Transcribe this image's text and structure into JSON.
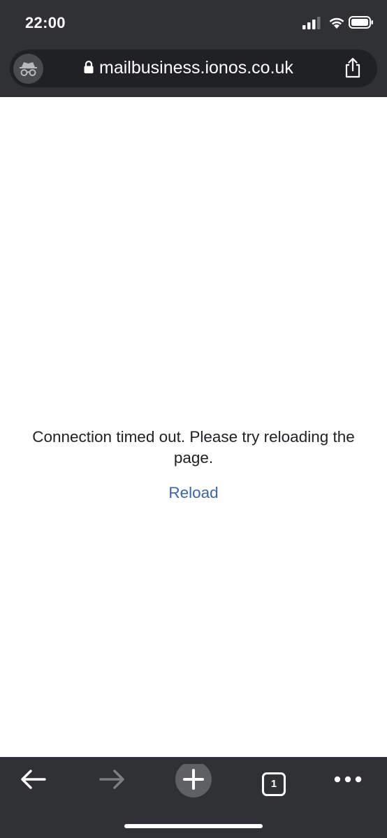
{
  "status_bar": {
    "time": "22:00",
    "icons": [
      "signal-icon",
      "wifi-icon",
      "battery-icon"
    ]
  },
  "address_bar": {
    "url": "mailbusiness.ionos.co.uk",
    "icons": [
      "incognito-icon",
      "lock-icon",
      "share-icon"
    ]
  },
  "page": {
    "error_message": "Connection timed out. Please try reloading the page.",
    "reload_label": "Reload"
  },
  "toolbar": {
    "tab_count": "1",
    "buttons": [
      "back-icon",
      "forward-icon",
      "new-tab-icon",
      "tab-switcher",
      "more-icon"
    ]
  },
  "colors": {
    "chrome_background": "#303135",
    "url_bar_background": "#202124",
    "link": "#3c65a8",
    "text": "#202124"
  }
}
